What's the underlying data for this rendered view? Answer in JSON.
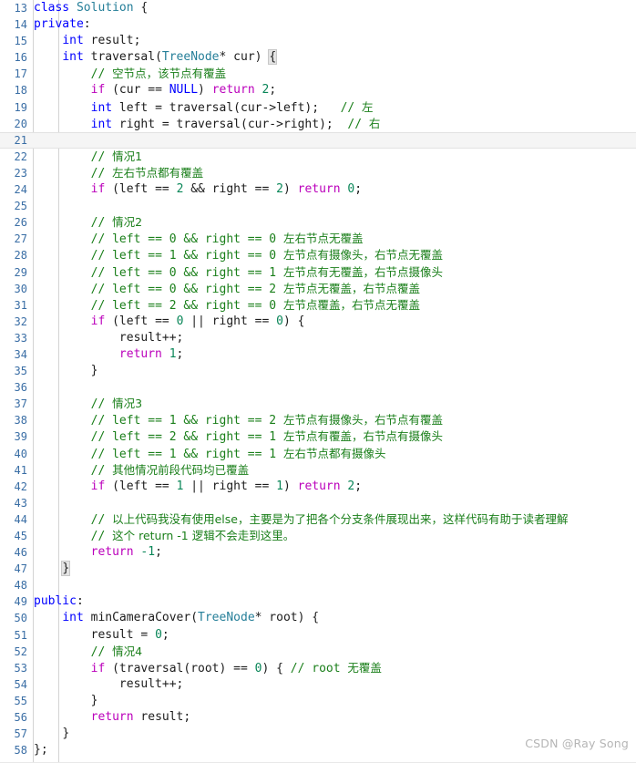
{
  "editor": {
    "language": "C++",
    "first_line_number": 13,
    "last_line_number": 58,
    "active_line_number": 21,
    "colors": {
      "background": "#ffffff",
      "line_number": "#3a6ea5",
      "keyword": "#0000ff",
      "control_keyword": "#bb00bb",
      "type": "#267f99",
      "number": "#098658",
      "comment": "#1a7f1a",
      "text": "#1c1c1c",
      "active_line": "#f5f5f5",
      "indent_guide": "#d3d3d3",
      "watermark": "#b5b5b5"
    }
  },
  "watermark": {
    "text": "CSDN @Ray Song"
  },
  "lines": [
    {
      "n": "13",
      "tokens": [
        {
          "c": "t-kw",
          "t": "class"
        },
        {
          "c": "t-punc",
          "t": " "
        },
        {
          "c": "t-cls",
          "t": "Solution"
        },
        {
          "c": "t-punc",
          "t": " {"
        }
      ]
    },
    {
      "n": "14",
      "tokens": [
        {
          "c": "t-acc",
          "t": "private"
        },
        {
          "c": "t-punc",
          "t": ":"
        }
      ]
    },
    {
      "n": "15",
      "tokens": [
        {
          "c": "t-punc",
          "t": "    "
        },
        {
          "c": "t-kw",
          "t": "int"
        },
        {
          "c": "t-id",
          "t": " result;"
        }
      ]
    },
    {
      "n": "16",
      "tokens": [
        {
          "c": "t-punc",
          "t": "    "
        },
        {
          "c": "t-kw",
          "t": "int"
        },
        {
          "c": "t-id",
          "t": " traversal("
        },
        {
          "c": "t-cls",
          "t": "TreeNode"
        },
        {
          "c": "t-id",
          "t": "* cur) "
        },
        {
          "c": "t-punc brace-box",
          "t": "{"
        }
      ]
    },
    {
      "n": "17",
      "tokens": [
        {
          "c": "t-punc",
          "t": "        "
        },
        {
          "c": "t-cmt",
          "t": "// "
        },
        {
          "c": "t-cmt-cn",
          "t": "空节点，该节点有覆盖"
        }
      ]
    },
    {
      "n": "18",
      "tokens": [
        {
          "c": "t-punc",
          "t": "        "
        },
        {
          "c": "t-ctl",
          "t": "if"
        },
        {
          "c": "t-id",
          "t": " (cur == "
        },
        {
          "c": "t-kw",
          "t": "NULL"
        },
        {
          "c": "t-id",
          "t": ") "
        },
        {
          "c": "t-ctl",
          "t": "return"
        },
        {
          "c": "t-id",
          "t": " "
        },
        {
          "c": "t-num",
          "t": "2"
        },
        {
          "c": "t-id",
          "t": ";"
        }
      ]
    },
    {
      "n": "19",
      "tokens": [
        {
          "c": "t-punc",
          "t": "        "
        },
        {
          "c": "t-kw",
          "t": "int"
        },
        {
          "c": "t-id",
          "t": " left = traversal(cur->left);   "
        },
        {
          "c": "t-cmt",
          "t": "// "
        },
        {
          "c": "t-cmt-cn",
          "t": "左"
        }
      ]
    },
    {
      "n": "20",
      "tokens": [
        {
          "c": "t-punc",
          "t": "        "
        },
        {
          "c": "t-kw",
          "t": "int"
        },
        {
          "c": "t-id",
          "t": " right = traversal(cur->right);  "
        },
        {
          "c": "t-cmt",
          "t": "// "
        },
        {
          "c": "t-cmt-cn",
          "t": "右"
        }
      ]
    },
    {
      "n": "21",
      "active": true,
      "tokens": []
    },
    {
      "n": "22",
      "tokens": [
        {
          "c": "t-punc",
          "t": "        "
        },
        {
          "c": "t-cmt",
          "t": "// "
        },
        {
          "c": "t-cmt-cn",
          "t": "情况1"
        }
      ]
    },
    {
      "n": "23",
      "tokens": [
        {
          "c": "t-punc",
          "t": "        "
        },
        {
          "c": "t-cmt",
          "t": "// "
        },
        {
          "c": "t-cmt-cn",
          "t": "左右节点都有覆盖"
        }
      ]
    },
    {
      "n": "24",
      "tokens": [
        {
          "c": "t-punc",
          "t": "        "
        },
        {
          "c": "t-ctl",
          "t": "if"
        },
        {
          "c": "t-id",
          "t": " (left == "
        },
        {
          "c": "t-num",
          "t": "2"
        },
        {
          "c": "t-id",
          "t": " && right == "
        },
        {
          "c": "t-num",
          "t": "2"
        },
        {
          "c": "t-id",
          "t": ") "
        },
        {
          "c": "t-ctl",
          "t": "return"
        },
        {
          "c": "t-id",
          "t": " "
        },
        {
          "c": "t-num",
          "t": "0"
        },
        {
          "c": "t-id",
          "t": ";"
        }
      ]
    },
    {
      "n": "25",
      "tokens": []
    },
    {
      "n": "26",
      "tokens": [
        {
          "c": "t-punc",
          "t": "        "
        },
        {
          "c": "t-cmt",
          "t": "// "
        },
        {
          "c": "t-cmt-cn",
          "t": "情况2"
        }
      ]
    },
    {
      "n": "27",
      "tokens": [
        {
          "c": "t-punc",
          "t": "        "
        },
        {
          "c": "t-cmt",
          "t": "// left == 0 && right == 0 "
        },
        {
          "c": "t-cmt-cn",
          "t": "左右节点无覆盖"
        }
      ]
    },
    {
      "n": "28",
      "tokens": [
        {
          "c": "t-punc",
          "t": "        "
        },
        {
          "c": "t-cmt",
          "t": "// left == 1 && right == 0 "
        },
        {
          "c": "t-cmt-cn",
          "t": "左节点有摄像头，右节点无覆盖"
        }
      ]
    },
    {
      "n": "29",
      "tokens": [
        {
          "c": "t-punc",
          "t": "        "
        },
        {
          "c": "t-cmt",
          "t": "// left == 0 && right == 1 "
        },
        {
          "c": "t-cmt-cn",
          "t": "左节点有无覆盖，右节点摄像头"
        }
      ]
    },
    {
      "n": "30",
      "tokens": [
        {
          "c": "t-punc",
          "t": "        "
        },
        {
          "c": "t-cmt",
          "t": "// left == 0 && right == 2 "
        },
        {
          "c": "t-cmt-cn",
          "t": "左节点无覆盖，右节点覆盖"
        }
      ]
    },
    {
      "n": "31",
      "tokens": [
        {
          "c": "t-punc",
          "t": "        "
        },
        {
          "c": "t-cmt",
          "t": "// left == 2 && right == 0 "
        },
        {
          "c": "t-cmt-cn",
          "t": "左节点覆盖，右节点无覆盖"
        }
      ]
    },
    {
      "n": "32",
      "tokens": [
        {
          "c": "t-punc",
          "t": "        "
        },
        {
          "c": "t-ctl",
          "t": "if"
        },
        {
          "c": "t-id",
          "t": " (left == "
        },
        {
          "c": "t-num",
          "t": "0"
        },
        {
          "c": "t-id",
          "t": " || right == "
        },
        {
          "c": "t-num",
          "t": "0"
        },
        {
          "c": "t-id",
          "t": ") {"
        }
      ]
    },
    {
      "n": "33",
      "tokens": [
        {
          "c": "t-punc",
          "t": "            "
        },
        {
          "c": "t-id",
          "t": "result++;"
        }
      ]
    },
    {
      "n": "34",
      "tokens": [
        {
          "c": "t-punc",
          "t": "            "
        },
        {
          "c": "t-ctl",
          "t": "return"
        },
        {
          "c": "t-id",
          "t": " "
        },
        {
          "c": "t-num",
          "t": "1"
        },
        {
          "c": "t-id",
          "t": ";"
        }
      ]
    },
    {
      "n": "35",
      "tokens": [
        {
          "c": "t-punc",
          "t": "        "
        },
        {
          "c": "t-id",
          "t": "}"
        }
      ]
    },
    {
      "n": "36",
      "tokens": []
    },
    {
      "n": "37",
      "tokens": [
        {
          "c": "t-punc",
          "t": "        "
        },
        {
          "c": "t-cmt",
          "t": "// "
        },
        {
          "c": "t-cmt-cn",
          "t": "情况3"
        }
      ]
    },
    {
      "n": "38",
      "tokens": [
        {
          "c": "t-punc",
          "t": "        "
        },
        {
          "c": "t-cmt",
          "t": "// left == 1 && right == 2 "
        },
        {
          "c": "t-cmt-cn",
          "t": "左节点有摄像头，右节点有覆盖"
        }
      ]
    },
    {
      "n": "39",
      "tokens": [
        {
          "c": "t-punc",
          "t": "        "
        },
        {
          "c": "t-cmt",
          "t": "// left == 2 && right == 1 "
        },
        {
          "c": "t-cmt-cn",
          "t": "左节点有覆盖，右节点有摄像头"
        }
      ]
    },
    {
      "n": "40",
      "tokens": [
        {
          "c": "t-punc",
          "t": "        "
        },
        {
          "c": "t-cmt",
          "t": "// left == 1 && right == 1 "
        },
        {
          "c": "t-cmt-cn",
          "t": "左右节点都有摄像头"
        }
      ]
    },
    {
      "n": "41",
      "tokens": [
        {
          "c": "t-punc",
          "t": "        "
        },
        {
          "c": "t-cmt",
          "t": "// "
        },
        {
          "c": "t-cmt-cn",
          "t": "其他情况前段代码均已覆盖"
        }
      ]
    },
    {
      "n": "42",
      "tokens": [
        {
          "c": "t-punc",
          "t": "        "
        },
        {
          "c": "t-ctl",
          "t": "if"
        },
        {
          "c": "t-id",
          "t": " (left == "
        },
        {
          "c": "t-num",
          "t": "1"
        },
        {
          "c": "t-id",
          "t": " || right == "
        },
        {
          "c": "t-num",
          "t": "1"
        },
        {
          "c": "t-id",
          "t": ") "
        },
        {
          "c": "t-ctl",
          "t": "return"
        },
        {
          "c": "t-id",
          "t": " "
        },
        {
          "c": "t-num",
          "t": "2"
        },
        {
          "c": "t-id",
          "t": ";"
        }
      ]
    },
    {
      "n": "43",
      "tokens": []
    },
    {
      "n": "44",
      "tokens": [
        {
          "c": "t-punc",
          "t": "        "
        },
        {
          "c": "t-cmt",
          "t": "// "
        },
        {
          "c": "t-cmt-cn",
          "t": "以上代码我没有使用else，主要是为了把各个分支条件展现出来，这样代码有助于读者理解"
        }
      ]
    },
    {
      "n": "45",
      "tokens": [
        {
          "c": "t-punc",
          "t": "        "
        },
        {
          "c": "t-cmt",
          "t": "// "
        },
        {
          "c": "t-cmt-cn",
          "t": "这个 return -1 逻辑不会走到这里。"
        }
      ]
    },
    {
      "n": "46",
      "tokens": [
        {
          "c": "t-punc",
          "t": "        "
        },
        {
          "c": "t-ctl",
          "t": "return"
        },
        {
          "c": "t-id",
          "t": " "
        },
        {
          "c": "t-num",
          "t": "-1"
        },
        {
          "c": "t-id",
          "t": ";"
        }
      ]
    },
    {
      "n": "47",
      "tokens": [
        {
          "c": "t-punc",
          "t": "    "
        },
        {
          "c": "t-punc brace-box",
          "t": "}"
        }
      ]
    },
    {
      "n": "48",
      "tokens": []
    },
    {
      "n": "49",
      "tokens": [
        {
          "c": "t-acc",
          "t": "public"
        },
        {
          "c": "t-punc",
          "t": ":"
        }
      ]
    },
    {
      "n": "50",
      "tokens": [
        {
          "c": "t-punc",
          "t": "    "
        },
        {
          "c": "t-kw",
          "t": "int"
        },
        {
          "c": "t-id",
          "t": " minCameraCover("
        },
        {
          "c": "t-cls",
          "t": "TreeNode"
        },
        {
          "c": "t-id",
          "t": "* root) {"
        }
      ]
    },
    {
      "n": "51",
      "tokens": [
        {
          "c": "t-punc",
          "t": "        "
        },
        {
          "c": "t-id",
          "t": "result = "
        },
        {
          "c": "t-num",
          "t": "0"
        },
        {
          "c": "t-id",
          "t": ";"
        }
      ]
    },
    {
      "n": "52",
      "tokens": [
        {
          "c": "t-punc",
          "t": "        "
        },
        {
          "c": "t-cmt",
          "t": "// "
        },
        {
          "c": "t-cmt-cn",
          "t": "情况4"
        }
      ]
    },
    {
      "n": "53",
      "tokens": [
        {
          "c": "t-punc",
          "t": "        "
        },
        {
          "c": "t-ctl",
          "t": "if"
        },
        {
          "c": "t-id",
          "t": " (traversal(root) == "
        },
        {
          "c": "t-num",
          "t": "0"
        },
        {
          "c": "t-id",
          "t": ") { "
        },
        {
          "c": "t-cmt",
          "t": "// root "
        },
        {
          "c": "t-cmt-cn",
          "t": "无覆盖"
        }
      ]
    },
    {
      "n": "54",
      "tokens": [
        {
          "c": "t-punc",
          "t": "            "
        },
        {
          "c": "t-id",
          "t": "result++;"
        }
      ]
    },
    {
      "n": "55",
      "tokens": [
        {
          "c": "t-punc",
          "t": "        "
        },
        {
          "c": "t-id",
          "t": "}"
        }
      ]
    },
    {
      "n": "56",
      "tokens": [
        {
          "c": "t-punc",
          "t": "        "
        },
        {
          "c": "t-ctl",
          "t": "return"
        },
        {
          "c": "t-id",
          "t": " result;"
        }
      ]
    },
    {
      "n": "57",
      "tokens": [
        {
          "c": "t-punc",
          "t": "    "
        },
        {
          "c": "t-id",
          "t": "}"
        }
      ]
    },
    {
      "n": "58",
      "tokens": [
        {
          "c": "t-id",
          "t": "};"
        }
      ]
    }
  ]
}
